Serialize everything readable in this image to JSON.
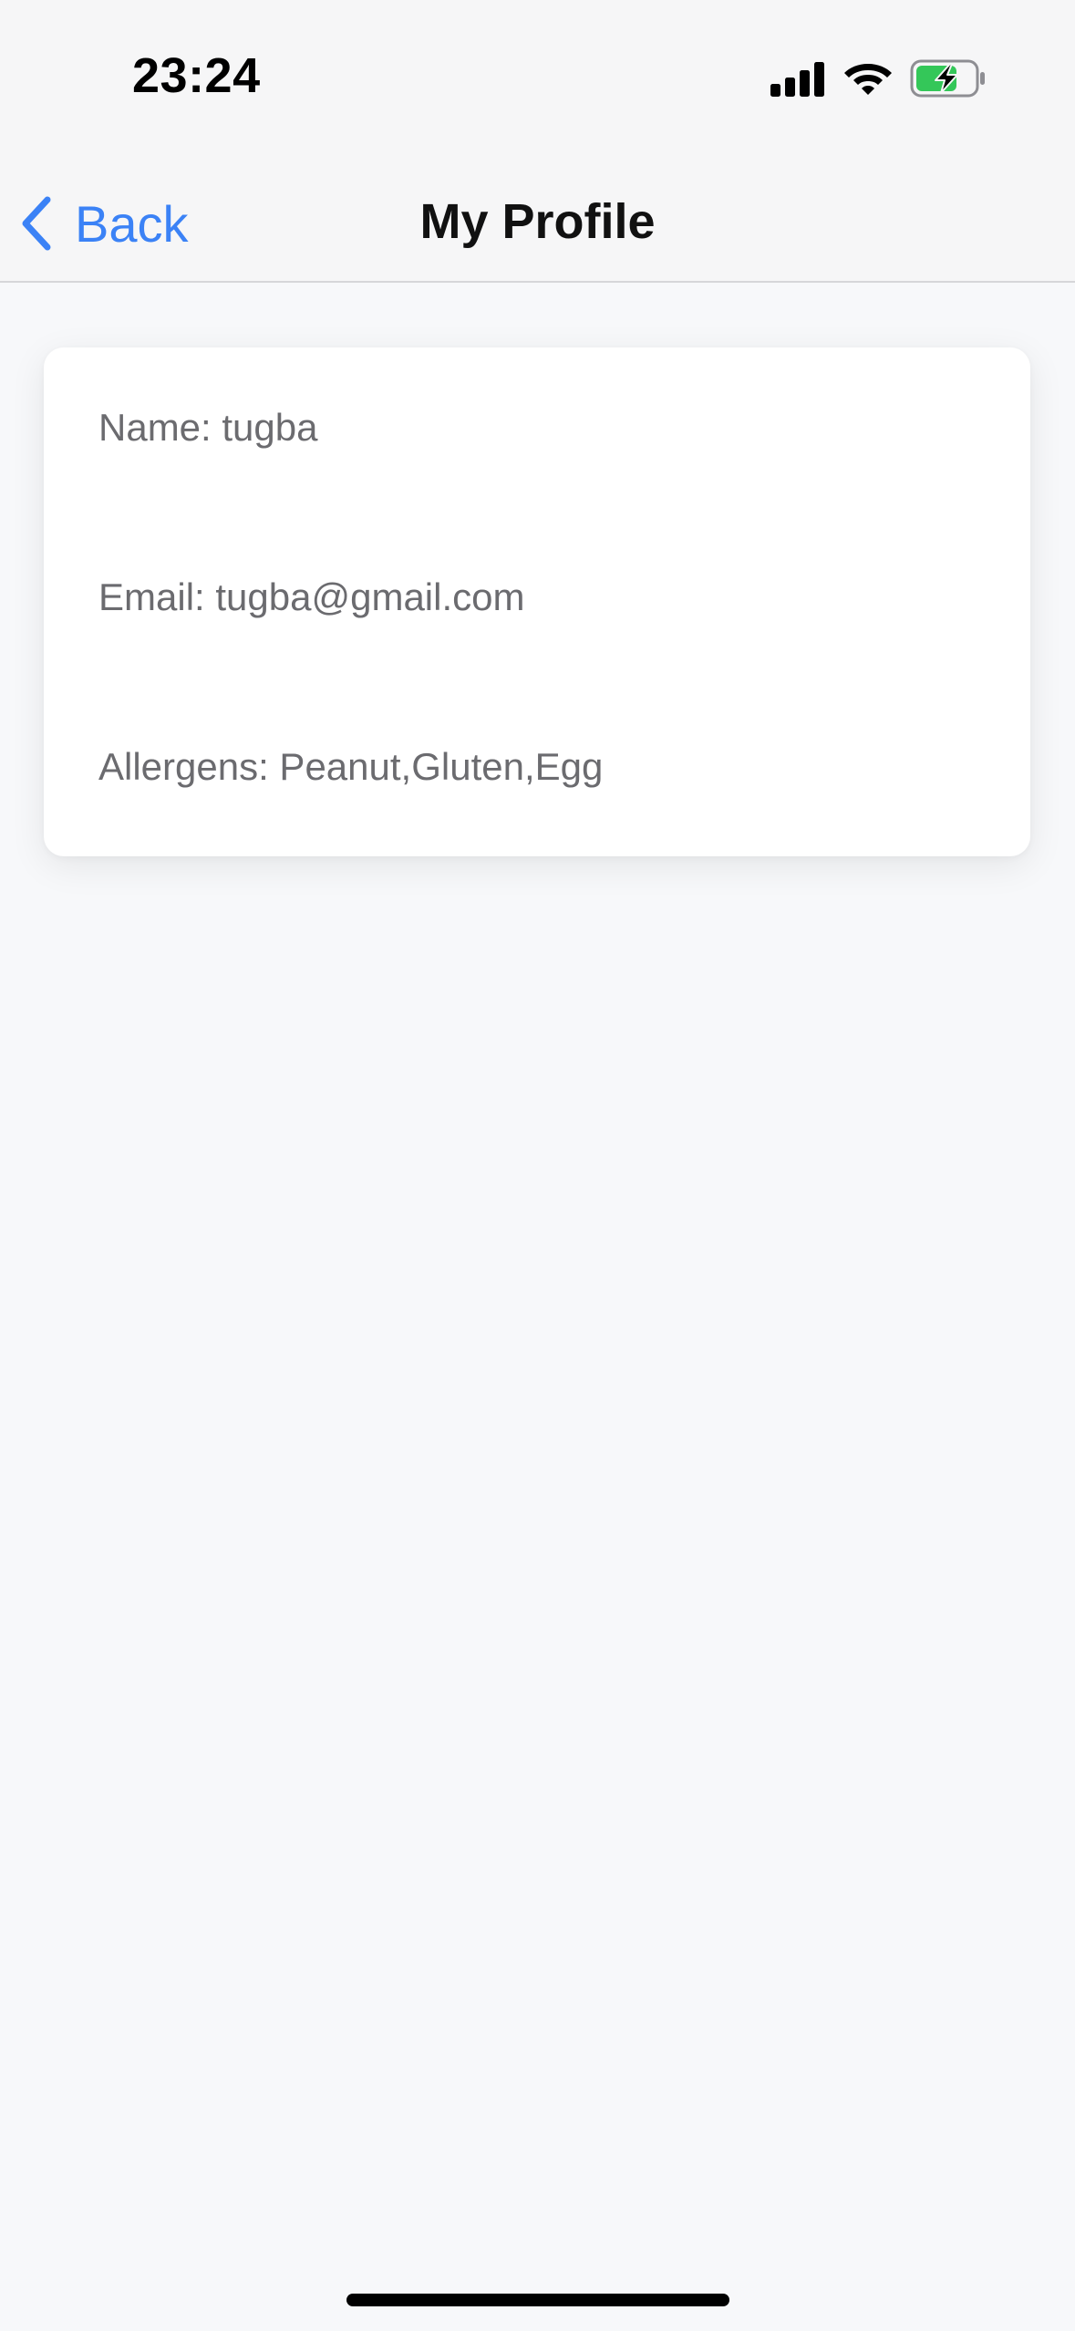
{
  "status_bar": {
    "time": "23:24",
    "icons": [
      "signal-icon",
      "wifi-icon",
      "battery-charging-icon"
    ],
    "battery_color": "#34c759"
  },
  "nav": {
    "back_label": "Back",
    "title": "My Profile",
    "accent_color": "#3b82f6"
  },
  "profile": {
    "name_text": "Name: tugba",
    "email_text": "Email: tugba@gmail.com",
    "allergens_text": "Allergens: Peanut,Gluten,Egg"
  }
}
